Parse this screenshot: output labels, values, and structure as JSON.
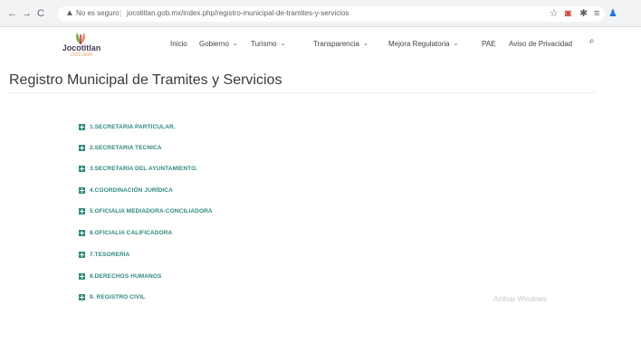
{
  "browser": {
    "back": "←",
    "forward": "→",
    "reload": "C",
    "warning_icon": "▲",
    "not_secure": "No es seguro",
    "separator": "|",
    "url": "jocotitlan.gob.mx/index.php/registro-municipal-de-tramites-y-servicios",
    "star_icon": "☆",
    "extension_icon": "◙",
    "puzzle_icon": "✱",
    "queue_icon": "≡",
    "profile_icon": "♟"
  },
  "site": {
    "logo_name": "Jocotitlan",
    "logo_sub": "2022-2024",
    "brand_color": "#2f8a7d"
  },
  "nav": {
    "items": [
      {
        "label": "Inicio",
        "chevron": ""
      },
      {
        "label": "Gobierno",
        "chevron": "⌄"
      },
      {
        "label": "Turismo",
        "chevron": "⌄"
      },
      {
        "label": "Transparencia",
        "chevron": "⌄"
      },
      {
        "label": "Mejora Regulatoria",
        "chevron": "⌄"
      },
      {
        "label": "PAE",
        "chevron": ""
      },
      {
        "label": "Aviso de Privacidad",
        "chevron": ""
      }
    ],
    "search_icon": "⌕"
  },
  "page": {
    "title": "Registro Municipal de Tramites y Servicios"
  },
  "list": {
    "items": [
      "1.SECRETARIA PARTICULAR.",
      "2.SECRETARIA TECNICA",
      "3.SECRETARIA DEL AYUNTAMIENTO.",
      "4.COORDINACIÓN JURÍDICA",
      "5.OFICIALIA MEDIADORA-CONCILIADORA",
      "6.OFICIALIA CALIFICADORA",
      "7.TESORERIA",
      "8.DERECHOS HUMANOS",
      "9. REGISTRO CIVIL"
    ]
  },
  "overlay": {
    "watermark": "Activar Windows"
  }
}
